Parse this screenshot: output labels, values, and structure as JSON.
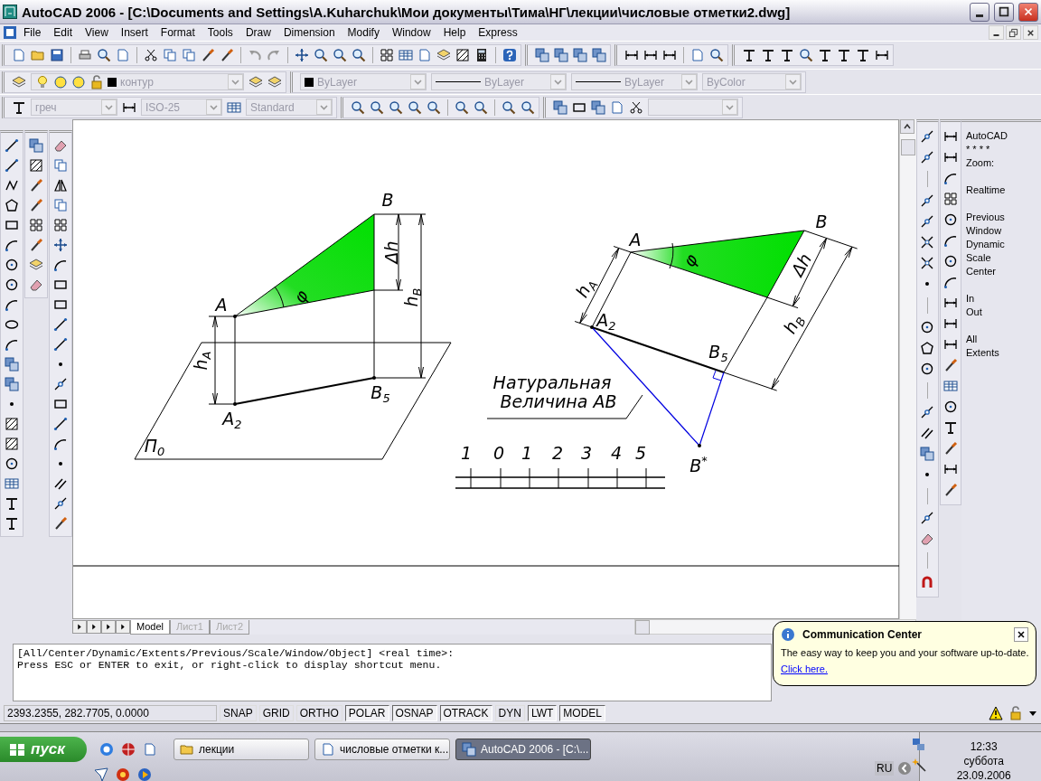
{
  "window": {
    "title": "AutoCAD 2006 - [C:\\Documents and Settings\\A.Kuharchuk\\Мои документы\\Тима\\НГ\\лекции\\числовые отметки2.dwg]"
  },
  "menu": [
    "File",
    "Edit",
    "View",
    "Insert",
    "Format",
    "Tools",
    "Draw",
    "Dimension",
    "Modify",
    "Window",
    "Help",
    "Express"
  ],
  "properties_combos": [
    {
      "kind": "layer",
      "value": "контур",
      "disabled": true
    },
    {
      "kind": "swatch",
      "value": "ByLayer",
      "disabled": true
    },
    {
      "kind": "line",
      "value": "ByLayer",
      "disabled": true
    },
    {
      "kind": "line",
      "value": "ByLayer",
      "disabled": true
    },
    {
      "kind": "plain",
      "value": "ByColor",
      "disabled": true
    }
  ],
  "style_combos": [
    {
      "kind": "plain",
      "value": "греч",
      "disabled": true
    },
    {
      "kind": "plain",
      "value": "ISO-25",
      "disabled": true
    },
    {
      "kind": "plain",
      "value": "Standard",
      "disabled": true
    }
  ],
  "drawing": {
    "left": {
      "point_b": "B",
      "point_a": "A",
      "angle": "φ",
      "delta_h": "Δh",
      "h_b": "h$_{B}$",
      "h_a": "h$_{A}$",
      "point_a2": "A$_{2}$",
      "point_b5": "B$_{5}$",
      "plane": "П$_{0}$"
    },
    "right": {
      "point_a": "A",
      "point_b": "B",
      "angle": "φ",
      "h_a": "h$_{A}$",
      "delta_h": "Δh",
      "h_b": "h$_{B}$",
      "point_a2": "A$_{2}$",
      "point_b5": "B$_{5}$",
      "point_b_star": "B$^{*}$"
    },
    "caption": [
      "Натуральная",
      "Величина АВ"
    ],
    "scale": [
      "1",
      "0",
      "1",
      "2",
      "3",
      "4",
      "5"
    ]
  },
  "layout_tabs": [
    {
      "label": "Model",
      "selected": true
    },
    {
      "label": "Лист1",
      "selected": false
    },
    {
      "label": "Лист2",
      "selected": false
    }
  ],
  "screen_menu": [
    [
      "AutoCAD",
      "* * * *",
      "Zoom:"
    ],
    [
      "Realtime"
    ],
    [
      "Previous",
      "Window",
      "Dynamic",
      "Scale",
      "Center"
    ],
    [
      "In",
      "Out"
    ],
    [
      "All",
      "Extents"
    ]
  ],
  "command_lines": [
    "[All/Center/Dynamic/Extents/Previous/Scale/Window/Object] <real time>:",
    "Press ESC or ENTER to exit, or right-click to display shortcut menu."
  ],
  "status_bar": {
    "coordinates": "2393.2355, 282.7705, 0.0000",
    "toggles": [
      {
        "label": "SNAP",
        "on": false
      },
      {
        "label": "GRID",
        "on": false
      },
      {
        "label": "ORTHO",
        "on": false
      },
      {
        "label": "POLAR",
        "on": true
      },
      {
        "label": "OSNAP",
        "on": true
      },
      {
        "label": "OTRACK",
        "on": true
      },
      {
        "label": "DYN",
        "on": false
      },
      {
        "label": "LWT",
        "on": true
      },
      {
        "label": "MODEL",
        "on": true
      }
    ]
  },
  "notification": {
    "title": "Communication Center",
    "message": "The easy way to keep you and your software up-to-date.",
    "link": "Click here."
  },
  "taskbar": {
    "start": "пуск",
    "tasks": [
      {
        "label": "лекции",
        "selected": false
      },
      {
        "label": "числовые отметки к...",
        "selected": false
      },
      {
        "label": "AutoCAD 2006 - [C:\\...",
        "selected": true
      }
    ],
    "language": "RU",
    "time": "12:33",
    "weekday": "суббота",
    "date": "23.09.2006"
  }
}
